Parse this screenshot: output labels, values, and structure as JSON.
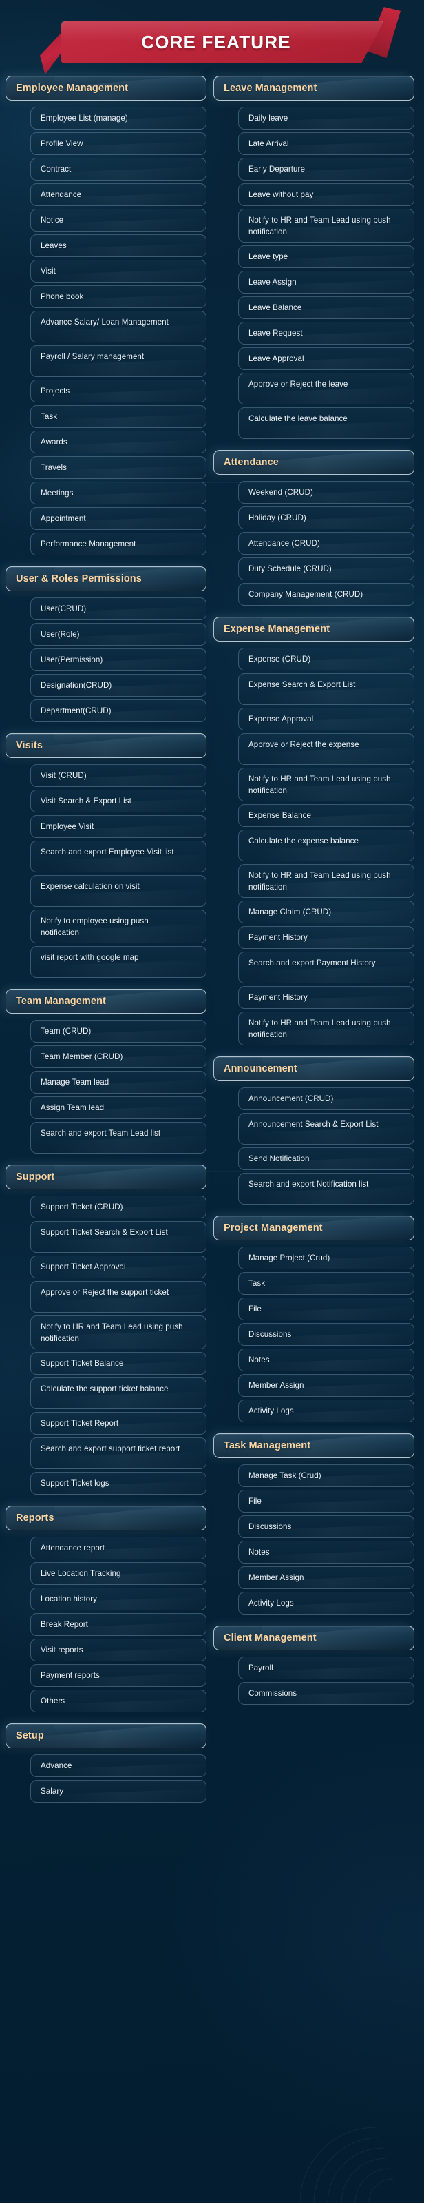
{
  "header": {
    "title": "CORE FEATURE",
    "ribbon_color": "#bc2539",
    "background_color": "#072338",
    "accent_text_color": "#fbd6a4"
  },
  "columns": [
    {
      "id": "left",
      "sections": [
        {
          "title": "Employee Management",
          "items": [
            "Employee List (manage)",
            "Profile View",
            "Contract",
            "Attendance",
            "Notice",
            "Leaves",
            "Visit",
            "Phone book",
            "Advance Salary/ Loan Management",
            "Payroll / Salary management",
            "Projects",
            "Task",
            "Awards",
            "Travels",
            "Meetings",
            "Appointment",
            "Performance Management"
          ]
        },
        {
          "title": "User & Roles Permissions",
          "items": [
            "User(CRUD)",
            "User(Role)",
            "User(Permission)",
            "Designation(CRUD)",
            "Department(CRUD)"
          ]
        },
        {
          "title": "Visits",
          "items": [
            "Visit (CRUD)",
            "Visit Search & Export List",
            "Employee Visit",
            "Search and export Employee Visit list",
            "Expense calculation on visit",
            "Notify to employee using push notification",
            "visit report with google map"
          ]
        },
        {
          "title": "Team Management",
          "items": [
            "Team (CRUD)",
            "Team Member (CRUD)",
            "Manage Team lead",
            "Assign Team lead",
            "Search and export Team Lead list"
          ]
        },
        {
          "title": "Support",
          "items": [
            "Support Ticket (CRUD)",
            "Support Ticket Search & Export List",
            "Support Ticket Approval",
            "Approve or Reject the support ticket",
            "Notify to HR and Team Lead using push notification",
            "Support Ticket Balance",
            "Calculate the support ticket balance",
            "Support Ticket Report",
            "Search and export support ticket report",
            "Support Ticket logs"
          ]
        },
        {
          "title": "Reports",
          "items": [
            "Attendance report",
            "Live Location Tracking",
            "Location history",
            "Break Report",
            "Visit reports",
            "Payment reports",
            "Others"
          ]
        },
        {
          "title": "Setup",
          "items": [
            "Advance",
            "Salary"
          ]
        }
      ]
    },
    {
      "id": "right",
      "sections": [
        {
          "title": "Leave Management",
          "items": [
            "Daily leave",
            "Late Arrival",
            "Early Departure",
            "Leave without pay",
            "Notify to HR and Team Lead using push notification",
            "Leave type",
            "Leave Assign",
            "Leave Balance",
            "Leave Request",
            "Leave Approval",
            "Approve or Reject the leave",
            "Calculate the leave balance"
          ]
        },
        {
          "title": "Attendance",
          "items": [
            "Weekend (CRUD)",
            "Holiday (CRUD)",
            "Attendance (CRUD)",
            "Duty Schedule (CRUD)",
            "Company Management (CRUD)"
          ]
        },
        {
          "title": "Expense Management",
          "items": [
            "Expense (CRUD)",
            "Expense Search & Export List",
            "Expense Approval",
            "Approve or Reject the expense",
            "Notify to HR and Team Lead using push notification",
            "Expense Balance",
            "Calculate the expense balance",
            "Notify to HR and Team Lead using push notification",
            "Manage Claim (CRUD)",
            "Payment History",
            "Search and export Payment History",
            "Payment History",
            "Notify to HR and Team Lead using push notification"
          ]
        },
        {
          "title": "Announcement",
          "items": [
            "Announcement (CRUD)",
            "Announcement Search & Export List",
            "Send Notification",
            "Search and export Notification list"
          ]
        },
        {
          "title": "Project Management",
          "items": [
            "Manage Project (Crud)",
            "Task",
            "File",
            "Discussions",
            "Notes",
            "Member Assign",
            "Activity Logs"
          ]
        },
        {
          "title": "Task Management",
          "items": [
            "Manage Task (Crud)",
            "File",
            "Discussions",
            "Notes",
            "Member Assign",
            "Activity Logs"
          ]
        },
        {
          "title": "Client Management",
          "items": [
            "Payroll",
            "Commissions"
          ]
        }
      ]
    }
  ]
}
